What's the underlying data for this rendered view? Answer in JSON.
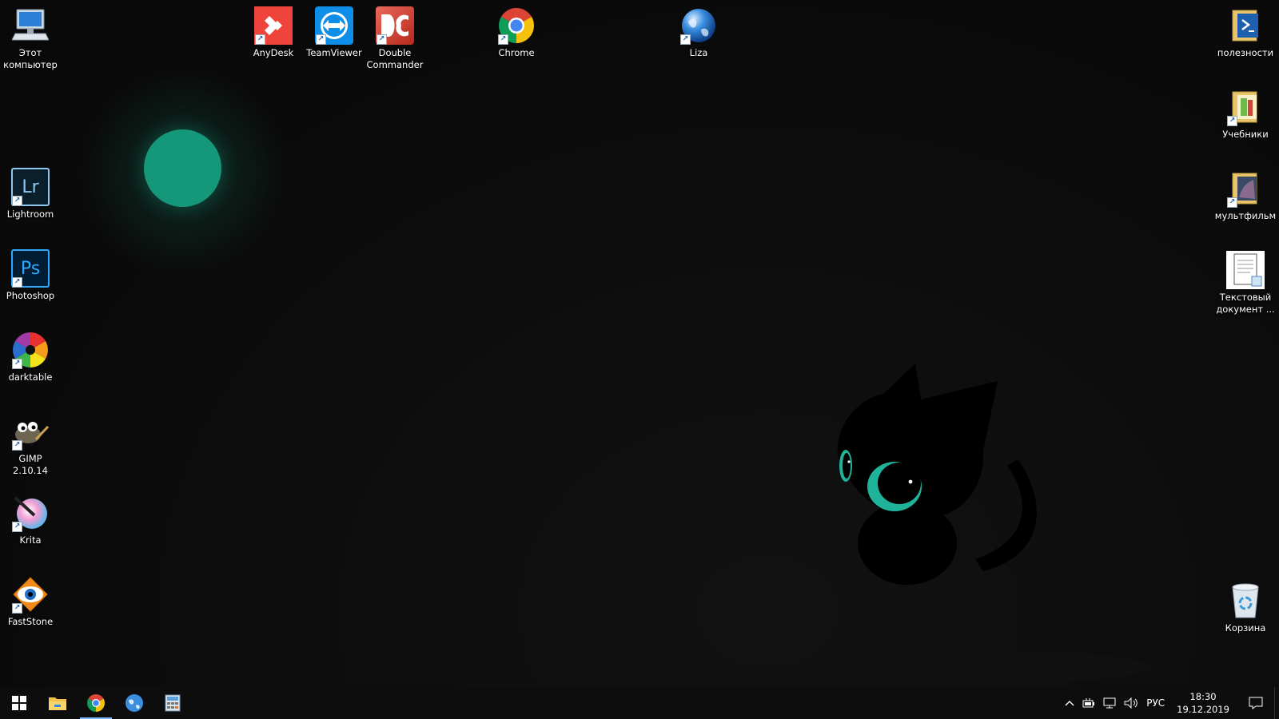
{
  "desktop": {
    "top_icons": [
      {
        "label": "AnyDesk",
        "icon": "anydesk-icon"
      },
      {
        "label": "TeamViewer",
        "icon": "teamviewer-icon"
      },
      {
        "label": "Double Commander",
        "icon": "double-commander-icon"
      },
      {
        "label": "Chrome",
        "icon": "chrome-icon"
      },
      {
        "label": "Liza",
        "icon": "globe-icon"
      }
    ],
    "left_icons": [
      {
        "label": "Этот компьютер",
        "icon": "computer-icon"
      },
      {
        "label": "Lightroom",
        "icon": "lightroom-icon",
        "glyph": "Lr"
      },
      {
        "label": "Photoshop",
        "icon": "photoshop-icon",
        "glyph": "Ps"
      },
      {
        "label": "darktable",
        "icon": "darktable-icon"
      },
      {
        "label": "GIMP 2.10.14",
        "icon": "gimp-icon"
      },
      {
        "label": "Krita",
        "icon": "krita-icon"
      },
      {
        "label": "FastStone",
        "icon": "faststone-icon"
      }
    ],
    "right_icons": [
      {
        "label": "полезности",
        "icon": "powershell-folder-icon"
      },
      {
        "label": "Учебники",
        "icon": "folder-icon"
      },
      {
        "label": "мультфильм",
        "icon": "folder-icon"
      },
      {
        "label": "Текстовый документ ...",
        "icon": "text-document-icon"
      },
      {
        "label": "Корзина",
        "icon": "recycle-bin-icon"
      }
    ]
  },
  "taskbar": {
    "pinned": [
      "start-icon",
      "file-explorer-icon",
      "chrome-icon",
      "globe-icon",
      "calculator-icon"
    ],
    "active_index": 2,
    "tray": {
      "language": "РУС",
      "time": "18:30",
      "date": "19.12.2019"
    }
  },
  "colors": {
    "background": "#0b0b0b",
    "moon": "#15977a",
    "cat_eye": "#1fb39a",
    "taskbar": "#0d0d0d",
    "active_indicator": "#7eb6ff"
  }
}
